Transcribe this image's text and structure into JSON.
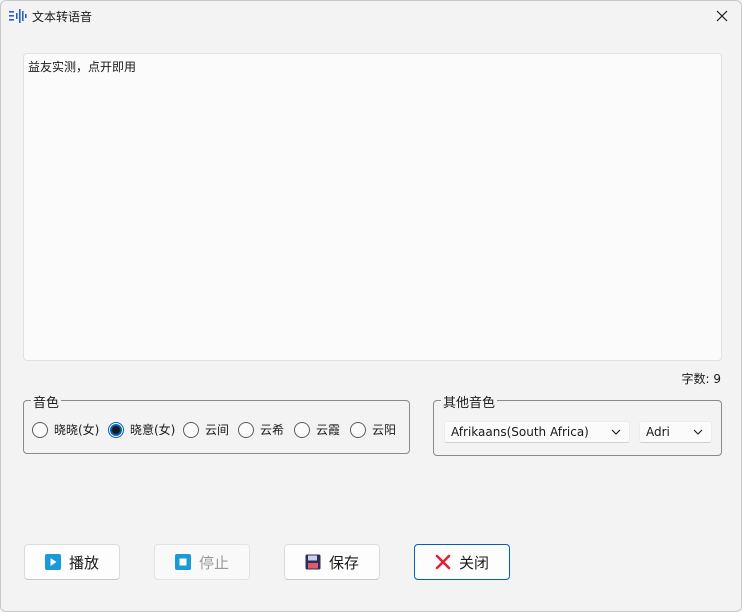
{
  "window": {
    "title": "文本转语音"
  },
  "editor": {
    "text": "益友实测，点开即用"
  },
  "char_count": "字数: 9",
  "voice_group": {
    "legend": "音色",
    "options": [
      {
        "label": "晓晓(女)",
        "checked": false
      },
      {
        "label": "晓意(女)",
        "checked": true
      },
      {
        "label": "云间",
        "checked": false
      },
      {
        "label": "云希",
        "checked": false
      },
      {
        "label": "云霞",
        "checked": false
      },
      {
        "label": "云阳",
        "checked": false
      }
    ]
  },
  "other_voice": {
    "legend": "其他音色",
    "language": "Afrikaans(South Africa)",
    "voice": "Adri"
  },
  "buttons": {
    "play": "播放",
    "stop": "停止",
    "save": "保存",
    "close": "关闭"
  },
  "colors": {
    "accent": "#005fb8",
    "play_icon": "#1a9ad6",
    "stop_icon": "#1a9ad6",
    "close_icon": "#e0223a"
  }
}
